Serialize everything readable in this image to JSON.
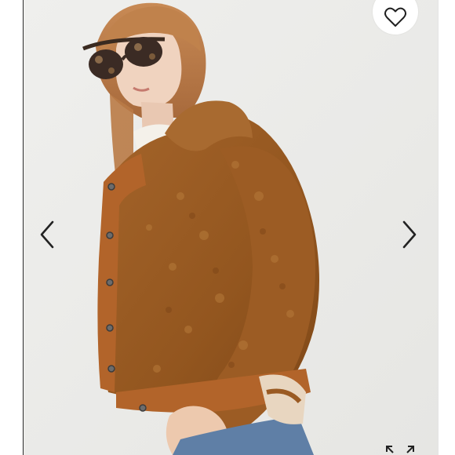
{
  "listing": {
    "image_description": "",
    "colors": {
      "jacket": "#9a5a22",
      "trim": "#b2642a",
      "background": "#ececea"
    }
  },
  "controls": {
    "prev_icon": "chevron-left-icon",
    "next_icon": "chevron-right-icon",
    "favorite_icon": "heart-outline-icon",
    "expand_icon": "expand-icon"
  }
}
